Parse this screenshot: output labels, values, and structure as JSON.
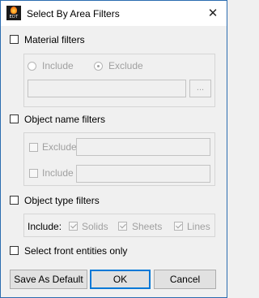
{
  "window": {
    "title": "Select By Area Filters",
    "close_glyph": "✕",
    "icon_text": "EDT"
  },
  "material": {
    "label": "Material filters",
    "include_label": "Include",
    "exclude_label": "Exclude",
    "selected": "Exclude",
    "value": "",
    "browse_label": "..."
  },
  "object_name": {
    "label": "Object name filters",
    "exclude_label": "Exclude",
    "include_label": "Include",
    "exclude_value": "",
    "include_value": ""
  },
  "object_type": {
    "label": "Object type filters",
    "include_label": "Include:",
    "solids_label": "Solids",
    "sheets_label": "Sheets",
    "lines_label": "Lines"
  },
  "front_only": {
    "label": "Select front entities only"
  },
  "buttons": {
    "save_default": "Save As Default",
    "ok": "OK",
    "cancel": "Cancel"
  },
  "colors": {
    "accent": "#0078d7",
    "disabled_text": "#a0a0a0"
  }
}
